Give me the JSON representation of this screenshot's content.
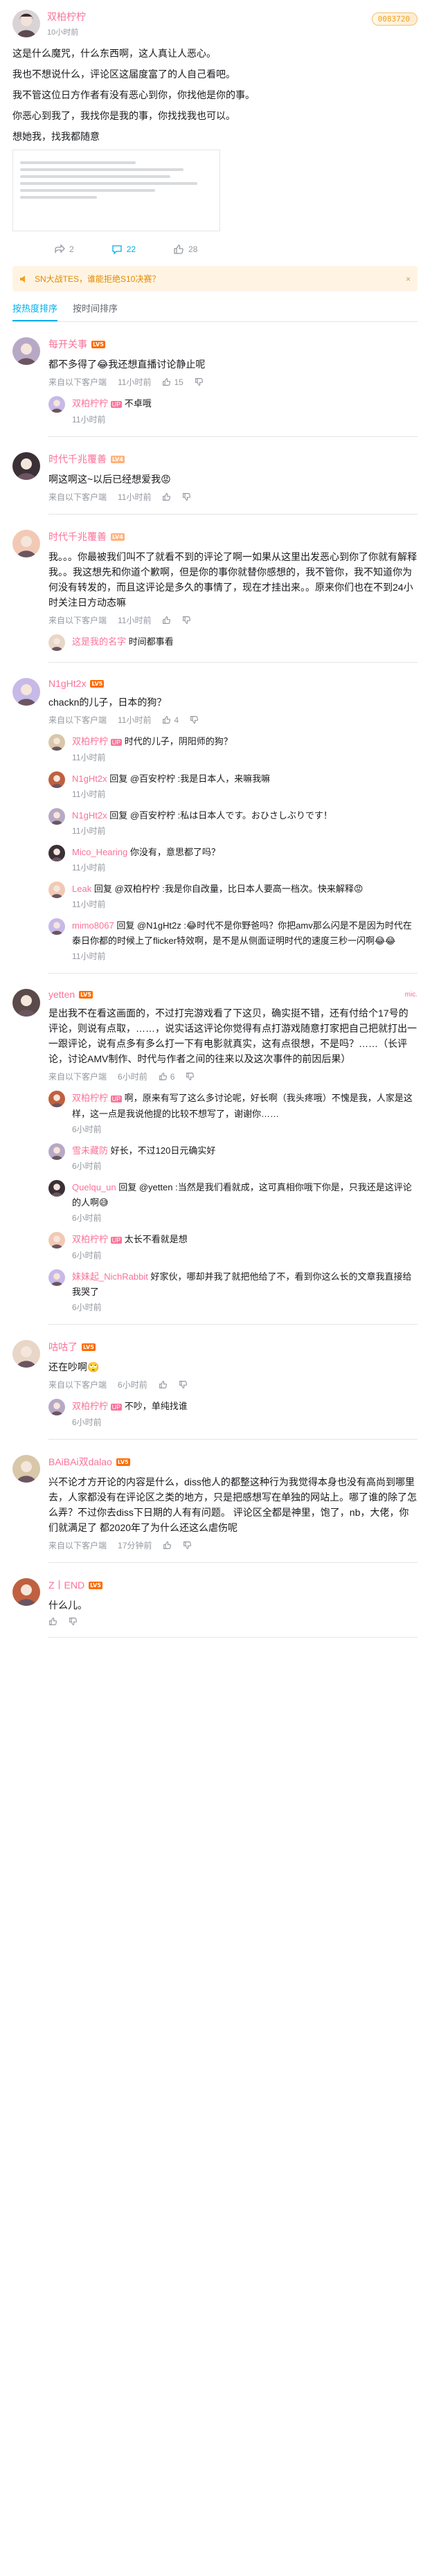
{
  "post": {
    "author": "双柏柠柠",
    "time": "10小时前",
    "badge": "0083720",
    "paragraphs": [
      "这是什么魔咒，什么东西啊，这人真让人恶心。",
      "我也不想说什么，评论区这届度富了的人自己看吧。",
      "我不管这位日方作者有没有恶心到你，你找他是你的事。",
      "你恶心到我了，我找你是我的事，你找找我也可以。",
      "想她我，找我都随意"
    ],
    "actions": {
      "share": "2",
      "comment": "22",
      "like": "28"
    }
  },
  "notice": {
    "text": "SN大战TES，谁能拒绝S10决赛？",
    "close": "×"
  },
  "tabs": {
    "hot": "按热度排序",
    "time": "按时间排序"
  },
  "comments": [
    {
      "name": "每开关事",
      "level": "LV5",
      "text": "都不多得了😂我还想直播讨论静止呢",
      "time": "来自以下客户端",
      "date": "11小时前",
      "likes": "15",
      "replies": [
        {
          "name": "双柏柠柠",
          "up": "UP",
          "text": "不卓哦",
          "time": "11小时前"
        }
      ]
    },
    {
      "name": "时代千兆覆善",
      "level": "LV4",
      "text": "啊这啊这~以后已经想爱我😡",
      "time": "来自以下客户端",
      "date": "11小时前",
      "likes": "",
      "replies": []
    },
    {
      "name": "时代千兆覆善",
      "level": "LV4",
      "text": "我。。。你最被我们叫不了就看不到的评论了啊一如果从这里出发恶心到你了你就有解释我。。我这想先和你道个歉啊，但是你的事你就替你感想的，我不管你，我不知道你为何没有转发的，而且这评论是多久的事情了，现在才挂出来。。原来你们也在不到24小时关注日方动态嘛",
      "time": "来自以下客户端",
      "date": "11小时前",
      "likes": "",
      "replies": [
        {
          "name": "这是我的名字",
          "up": "",
          "text": "时间都事看",
          "time": ""
        }
      ]
    },
    {
      "name": "N1gHt2x",
      "level": "LV5",
      "text": "chackn的儿子，日本的狗？",
      "time": "来自以下客户端",
      "date": "11小时前",
      "likes": "4",
      "replies": [
        {
          "name": "双柏柠柠",
          "up": "UP",
          "text": "时代的儿子，阴阳师的狗？",
          "time": "11小时前"
        },
        {
          "name": "N1gHt2x",
          "up": "",
          "text": "回复 @百安柠柠 :我是日本人，来嘛我嘛",
          "time": "11小时前"
        },
        {
          "name": "N1gHt2x",
          "up": "",
          "text": "回复 @百安柠柠 :私は日本人です。おひさしぶりです！",
          "time": "11小时前"
        },
        {
          "name": "Mico_Hearing",
          "up": "",
          "text": "你没有，意思都了吗？",
          "time": "11小时前"
        },
        {
          "name": "Leak",
          "up": "",
          "text": "回复 @双柏柠柠 :我是你自改量，比日本人要高一档次。快来解释😡",
          "time": "11小时前"
        },
        {
          "name": "mimo8067",
          "up": "",
          "text": "回复 @N1gHt2z :😂时代不是你野爸吗？你把amv那么闪是不是因为时代在泰日你都的时候上了flicker特效啊，是不是从侧面证明时代的速度三秒一闪啊😂😂",
          "time": "11小时前"
        }
      ]
    },
    {
      "name": "yetten",
      "level": "LV5",
      "badge": "mic.",
      "text": "是出我不在看这画面的，不过打完游戏看了下这贝，确实挺不错，还有付给个17号的评论，则说有点取，……，说实话这评论你觉得有点打游戏随意打家把自己把就打出一一跟评论，说有点多有多么打一下有电影就真实，这有点很想，不是吗？……（长评论，讨论AMV制作、时代与作者之间的往来以及这次事件的前因后果）",
      "time": "来自以下客户端",
      "date": "6小时前",
      "likes": "6",
      "replies": [
        {
          "name": "双柏柠柠",
          "up": "UP",
          "text": "啊，原来有写了这么多讨论呢，好长啊（我头疼哦）不愧是我，人家是这样，这一点是我说他提的比较不想写了，谢谢你……",
          "time": "6小时前"
        },
        {
          "name": "雪未藏防",
          "up": "",
          "text": "好长，不过120日元确实好",
          "time": "6小时前"
        },
        {
          "name": "Quelqu_un",
          "up": "",
          "text": "回复 @yetten :当然是我们看就成，这可真相你哦下你是，只我还是这评论的人啊😅",
          "time": "6小时前"
        },
        {
          "name": "双柏柠柠",
          "up": "UP",
          "text": "太长不看就是想",
          "time": "6小时前"
        },
        {
          "name": "妹妹起_NichRabbit",
          "up": "",
          "text": "好家伙，哪却并我了就把他给了不，看到你这么长的文章我直接给我哭了",
          "time": "6小时前"
        }
      ]
    },
    {
      "name": "咕咕了",
      "level": "LV5",
      "text": "还在吵啊🙄",
      "time": "来自以下客户端",
      "date": "6小时前",
      "likes": "",
      "replies": [
        {
          "name": "双柏柠柠",
          "up": "UP",
          "text": "不吵，单纯找谁",
          "time": "6小时前"
        }
      ]
    },
    {
      "name": "BAiBAi双dalao",
      "level": "LV5",
      "text": "兴不论才方开论的内容是什么，diss他人的都整这种行为我觉得本身也没有高尚到哪里去，人家都没有在评论区之类的地方，只是把感想写在单独的网站上。哪了谁的除了怎么弄？不过你去diss下日期的人有有问题。 评论区全都是神里，饱了，nb，大佬，你们就满足了 都2020年了为什么还这么虐伤呢",
      "time": "来自以下客户端",
      "date": "17分钟前",
      "likes": "",
      "replies": []
    },
    {
      "name": "Z丨END",
      "level": "LV5",
      "text": "什么儿。",
      "time": "",
      "date": "",
      "likes": "",
      "replies": []
    }
  ]
}
